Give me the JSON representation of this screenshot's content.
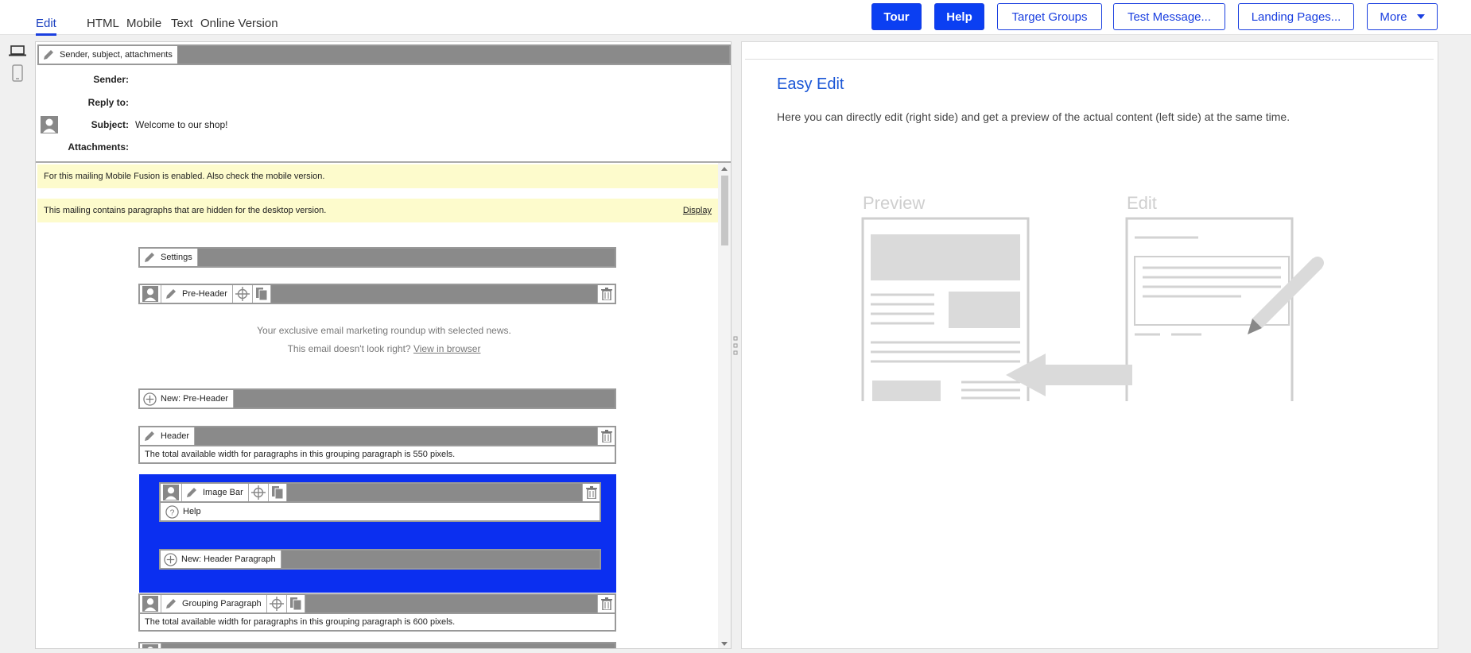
{
  "tabs": [
    {
      "label": "Edit",
      "active": true
    },
    {
      "label": "HTML"
    },
    {
      "label": "Mobile"
    },
    {
      "label": "Text"
    },
    {
      "label": "Online Version"
    }
  ],
  "toolbar": {
    "tour": "Tour",
    "help": "Help",
    "target_groups": "Target Groups",
    "test_message": "Test Message...",
    "landing_pages": "Landing Pages...",
    "more": "More"
  },
  "header_fields": {
    "bar_label": "Sender, subject, attachments",
    "sender_label": "Sender:",
    "sender_value": "",
    "reply_to_label": "Reply to:",
    "reply_to_value": "",
    "subject_label": "Subject:",
    "subject_value": "Welcome to our shop!",
    "attachments_label": "Attachments:",
    "attachments_value": ""
  },
  "notices": {
    "mobile_fusion": "For this mailing Mobile Fusion is enabled. Also check the mobile version.",
    "hidden_paragraphs": "This mailing contains paragraphs that are hidden for the desktop version.",
    "display_link": "Display"
  },
  "paragraphs": {
    "settings": "Settings",
    "pre_header": "Pre-Header",
    "preheader_line1": "Your exclusive email marketing roundup with selected news.",
    "preheader_line2": "This email doesn't look right?",
    "preheader_link": "View in browser",
    "new_pre_header": "New: Pre-Header",
    "header": "Header",
    "header_width": "The total available width for paragraphs in this grouping paragraph is 550 pixels.",
    "image_bar": "Image Bar",
    "help": "Help",
    "new_header_paragraph": "New: Header Paragraph",
    "grouping_paragraph": "Grouping Paragraph",
    "grouping_width": "The total available width for paragraphs in this grouping paragraph is 600 pixels."
  },
  "right_panel": {
    "title": "Easy Edit",
    "description": "Here you can directly edit (right side) and get a preview of the actual content (left side) at the same time.",
    "preview_label": "Preview",
    "edit_label": "Edit"
  },
  "colors": {
    "accent": "#0b3ff2",
    "highlight_block": "#0b2ff0",
    "notice_bg": "#fdfbcc",
    "bar_fill": "#8a8a8a"
  },
  "icons": [
    "desktop-icon",
    "mobile-icon",
    "pencil-icon",
    "avatar-icon",
    "crosshair-icon",
    "copy-icon",
    "trash-icon",
    "plus-icon",
    "help-icon",
    "chevron-down-icon"
  ]
}
